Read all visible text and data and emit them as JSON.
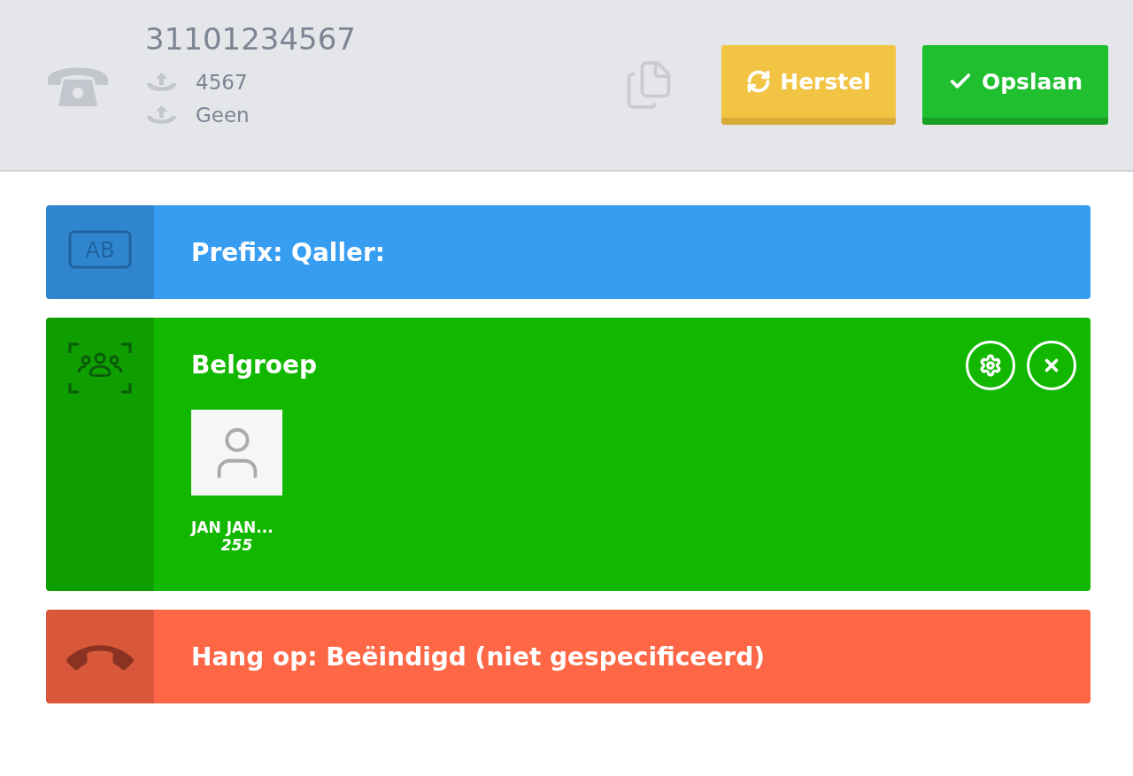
{
  "header": {
    "number": "31101234567",
    "forwards": [
      {
        "text": "4567"
      },
      {
        "text": "Geen"
      }
    ],
    "buttons": [
      {
        "kind": "reset",
        "label": "Herstel"
      },
      {
        "kind": "save",
        "label": "Opslaan"
      }
    ]
  },
  "blocks": [
    {
      "kind": "prefix",
      "color": "#379df0",
      "icon_text": "AB",
      "title": "Prefix: Qaller:"
    },
    {
      "kind": "group",
      "color": "#12b800",
      "title": "Belgroep",
      "members": [
        {
          "name": "JAN JAN...",
          "extension": "255"
        }
      ]
    },
    {
      "kind": "hangup",
      "color": "#fd6745",
      "title": "Hang op: Beëindigd (niet gespecificeerd)"
    }
  ]
}
